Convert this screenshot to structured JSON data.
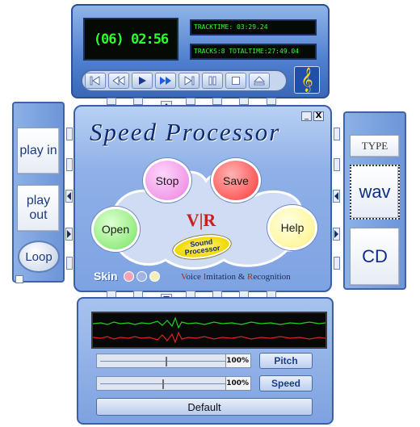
{
  "player": {
    "track_display": "(06) 02:56",
    "tracktime": "TRACKTIME: 03:29.24",
    "tracks": "TRACKS:8  TOTALTIME:27:49.04",
    "controls": [
      "previous-track",
      "rewind",
      "play",
      "fast-forward",
      "next-track",
      "pause",
      "stop",
      "eject"
    ]
  },
  "left_panel": {
    "play_in": "play in",
    "play_out": "play out",
    "loop": "Loop"
  },
  "right_panel": {
    "type": "TYPE",
    "wav": "wav",
    "cd": "CD"
  },
  "processor": {
    "title": "Speed Processor",
    "minimize": "_",
    "close": "X",
    "buttons": {
      "stop": "Stop",
      "save": "Save",
      "open": "Open",
      "help": "Help"
    },
    "logo": "V|R",
    "sound_processor": "Sound Processor",
    "skin_label": "Skin",
    "skin_colors": [
      "#f4a3b6",
      "#9db4e6",
      "#f2f0b8"
    ],
    "vir_text": {
      "v": "V",
      "oice": "oice ",
      "i": "I",
      "mitation": "mitation & ",
      "r": "R",
      "ecognition": "ecognition"
    }
  },
  "bottom": {
    "pitch_value": "100%",
    "pitch_label": "Pitch",
    "pitch_level": 0.45,
    "speed_value": "100%",
    "speed_label": "Speed",
    "speed_level": 0.43,
    "default": "Default"
  },
  "colors": {
    "lcd_green": "#2cff2c",
    "stop": "#f7a4f0",
    "save": "#ff6a6a",
    "open": "#9ef08e",
    "help": "#fff6a0"
  }
}
